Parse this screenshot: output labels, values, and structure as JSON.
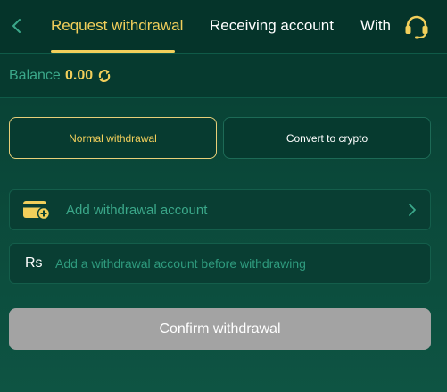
{
  "header": {
    "tabs": [
      {
        "label": "Request withdrawal",
        "active": true
      },
      {
        "label": "Receiving account",
        "active": false
      },
      {
        "label": "With",
        "active": false
      }
    ],
    "back_icon": "chevron-left-icon",
    "support_icon": "headset-icon"
  },
  "balance": {
    "label": "Balance",
    "value": "0.00",
    "refresh_icon": "refresh-icon"
  },
  "withdraw_types": [
    {
      "label": "Normal withdrawal",
      "selected": true
    },
    {
      "label": "Convert to crypto",
      "selected": false
    }
  ],
  "account": {
    "label": "Add withdrawal account",
    "icon": "wallet-add-icon"
  },
  "amount": {
    "currency_symbol": "Rs",
    "placeholder": "Add a withdrawal account before withdrawing",
    "value": ""
  },
  "confirm_label": "Confirm withdrawal",
  "colors": {
    "accent": "#f2cf5b",
    "background": "#0b4a3b",
    "muted_green": "#3ba88a",
    "disabled_button": "#a3a3a3"
  }
}
